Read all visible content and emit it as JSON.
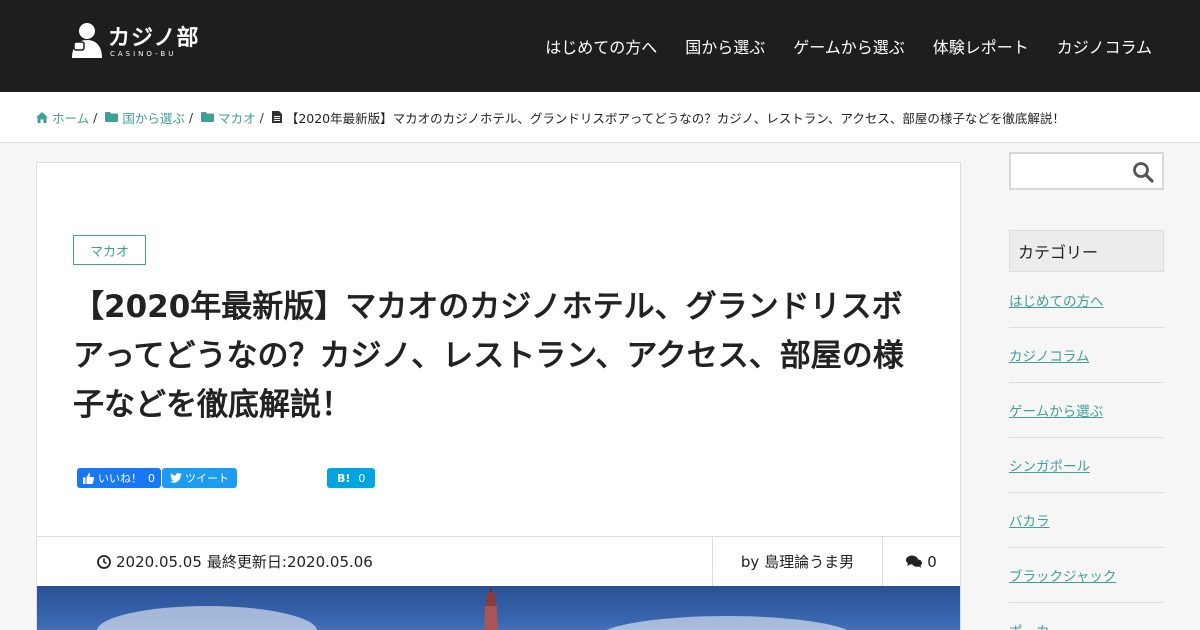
{
  "header": {
    "logo_text": "カジノ部",
    "logo_sub": "CASINO-BU",
    "nav": [
      "はじめての方へ",
      "国から選ぶ",
      "ゲームから選ぶ",
      "体験レポート",
      "カジノコラム"
    ]
  },
  "breadcrumb": {
    "items": [
      "ホーム",
      "国から選ぶ",
      "マカオ"
    ],
    "separator": "/",
    "current": "【2020年最新版】マカオのカジノホテル、グランドリスボアってどうなの？カジノ、レストラン、アクセス、部屋の様子などを徹底解説！"
  },
  "article": {
    "category_tag": "マカオ",
    "title": "【2020年最新版】マカオのカジノホテル、グランドリスボアってどうなの？カジノ、レストラン、アクセス、部屋の様子などを徹底解説！",
    "share": {
      "facebook_label": "いいね！",
      "facebook_count": "0",
      "twitter_label": "ツイート",
      "hatena_label": "B!",
      "hatena_count": "0"
    },
    "meta": {
      "published": "2020.05.05",
      "updated_label": "最終更新日:",
      "updated": "2020.05.06",
      "author": "by 島理論うま男",
      "comments": "0"
    }
  },
  "sidebar": {
    "heading": "カテゴリー",
    "categories": [
      "はじめての方へ",
      "カジノコラム",
      "ゲームから選ぶ",
      "シンガポール",
      "バカラ",
      "ブラックジャック",
      "ポーカー"
    ]
  },
  "colors": {
    "header_bg": "#1e1e1e",
    "accent": "#3fa097",
    "facebook": "#1877f2",
    "twitter": "#1d9bf0",
    "hatena": "#00a4de"
  }
}
